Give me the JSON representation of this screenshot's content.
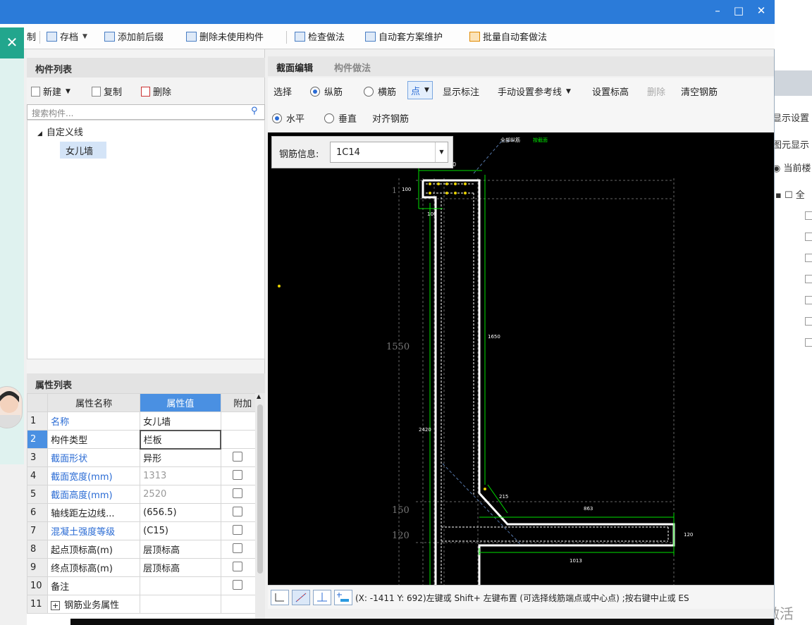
{
  "colors": {
    "titlebar": "#2b7bd9",
    "accent": "#2a6bd4",
    "canvas": "#000000",
    "rebar": "#00ff00",
    "concrete": "#ffffff"
  },
  "window_controls": {
    "minimize": "–",
    "maximize": "□",
    "close": "✕"
  },
  "toolbar": {
    "clipped_label": "制",
    "items": [
      {
        "label": "存档",
        "icon": "save-icon",
        "dropdown": true
      },
      {
        "label": "添加前后缀",
        "icon": "prefix-icon"
      },
      {
        "label": "删除未使用构件",
        "icon": "delete-unused-icon"
      },
      {
        "label": "检查做法",
        "icon": "check-icon"
      },
      {
        "label": "自动套方案维护",
        "icon": "scheme-icon"
      },
      {
        "label": "批量自动套做法",
        "icon": "batch-icon"
      }
    ]
  },
  "component_list": {
    "title": "构件列表",
    "new_label": "新建",
    "copy_label": "复制",
    "delete_label": "删除",
    "search_placeholder": "搜索构件...",
    "tree": {
      "group": "自定义线",
      "item": "女儿墙"
    }
  },
  "property_list": {
    "title": "属性列表",
    "headers": {
      "name": "属性名称",
      "value": "属性值",
      "extra": "附加"
    },
    "rows": [
      {
        "num": "1",
        "name": "名称",
        "value": "女儿墙",
        "blue": true,
        "grey": false,
        "check": false
      },
      {
        "num": "2",
        "name": "构件类型",
        "value": "栏板",
        "blue": false,
        "grey": false,
        "check": false
      },
      {
        "num": "3",
        "name": "截面形状",
        "value": "异形",
        "blue": true,
        "grey": false,
        "check": true
      },
      {
        "num": "4",
        "name": "截面宽度(mm)",
        "value": "1313",
        "blue": true,
        "grey": true,
        "check": true
      },
      {
        "num": "5",
        "name": "截面高度(mm)",
        "value": "2520",
        "blue": true,
        "grey": true,
        "check": true
      },
      {
        "num": "6",
        "name": "轴线距左边线...",
        "value": "(656.5)",
        "blue": false,
        "grey": false,
        "check": true
      },
      {
        "num": "7",
        "name": "混凝土强度等级",
        "value": "(C15)",
        "blue": true,
        "grey": false,
        "check": true
      },
      {
        "num": "8",
        "name": "起点顶标高(m)",
        "value": "层顶标高",
        "blue": false,
        "grey": false,
        "check": true
      },
      {
        "num": "9",
        "name": "终点顶标高(m)",
        "value": "层顶标高",
        "blue": false,
        "grey": false,
        "check": true
      },
      {
        "num": "10",
        "name": "备注",
        "value": "",
        "blue": false,
        "grey": false,
        "check": true
      },
      {
        "num": "11",
        "name": "钢筋业务属性",
        "value": "",
        "blue": false,
        "grey": false,
        "check": false,
        "expander": "+"
      }
    ]
  },
  "editor": {
    "tabs": {
      "active": "截面编辑",
      "inactive": "构件做法"
    },
    "toolbar1": {
      "select": "选择",
      "longitudinal": "纵筋",
      "transverse": "横筋",
      "point": "点",
      "show_label": "显示标注",
      "manual_ref": "手动设置参考线",
      "set_elev": "设置标高",
      "delete": "删除",
      "clear": "清空钢筋"
    },
    "toolbar2": {
      "horizontal": "水平",
      "vertical": "垂直",
      "align": "对齐钢筋"
    },
    "rebar_info": {
      "label": "钢筋信息:",
      "value": "1C14"
    },
    "drawing": {
      "header_white": "全部纵筋",
      "header_green": "按截面",
      "dims": {
        "top": "0",
        "left_top": "1",
        "box100": "100",
        "d100": "100",
        "d1550": "1550",
        "d1650": "1650",
        "d2420": "2420",
        "d215": "215",
        "d150": "150",
        "d863": "863",
        "d120L": "120",
        "d120R": "120",
        "d1013": "1013"
      }
    },
    "status": "(X: -1411 Y: 692)左键或 Shift+ 左键布置 (可选择线筋端点或中心点) ;按右键中止或 ES"
  },
  "background_panel": {
    "labels": [
      "显示设置",
      "图元显示",
      "当前楼",
      "全"
    ],
    "watermark": "激活"
  }
}
